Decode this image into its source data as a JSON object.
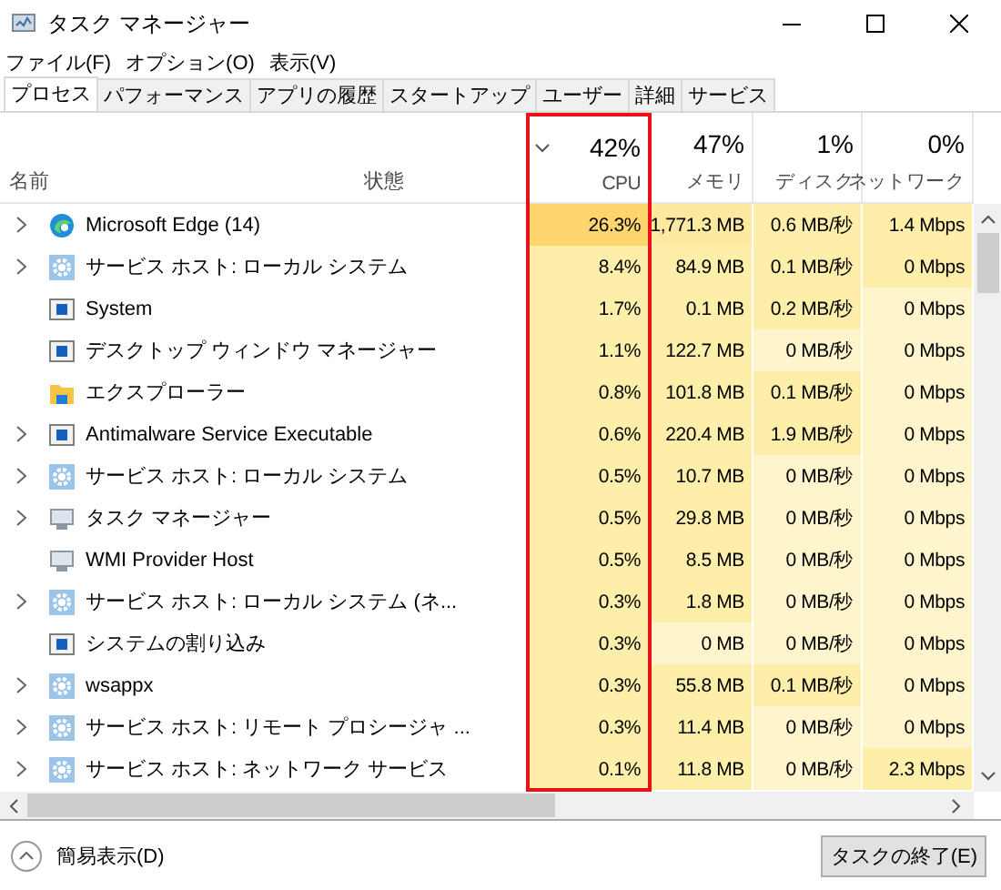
{
  "window": {
    "title": "タスク マネージャー"
  },
  "menu": [
    "ファイル(F)",
    "オプション(O)",
    "表示(V)"
  ],
  "tabs": [
    {
      "label": "プロセス",
      "selected": true
    },
    {
      "label": "パフォーマンス",
      "selected": false
    },
    {
      "label": "アプリの履歴",
      "selected": false
    },
    {
      "label": "スタートアップ",
      "selected": false
    },
    {
      "label": "ユーザー",
      "selected": false
    },
    {
      "label": "詳細",
      "selected": false
    },
    {
      "label": "サービス",
      "selected": false
    }
  ],
  "table": {
    "name_column": "名前",
    "status_column": "状態",
    "metric_columns": [
      {
        "total": "42%",
        "label": "CPU",
        "sorted": true,
        "highlighted": true
      },
      {
        "total": "47%",
        "label": "メモリ"
      },
      {
        "total": "1%",
        "label": "ディスク"
      },
      {
        "total": "0%",
        "label": "ネットワーク"
      }
    ],
    "rows": [
      {
        "name": "Microsoft Edge (14)",
        "kind": "edge",
        "expandable": true,
        "cells": [
          {
            "text": "26.3%",
            "color": "#ffd66e"
          },
          {
            "text": "1,771.3 MB",
            "color": "#fde9a0"
          },
          {
            "text": "0.6 MB/秒",
            "color": "#fdeeaa"
          },
          {
            "text": "1.4 Mbps",
            "color": "#fdeeaa"
          }
        ]
      },
      {
        "name": "サービス ホスト: ローカル システム",
        "kind": "gear",
        "expandable": true,
        "cells": [
          {
            "text": "8.4%",
            "color": "#fdeeaa"
          },
          {
            "text": "84.9 MB",
            "color": "#fdeeaa"
          },
          {
            "text": "0.1 MB/秒",
            "color": "#fdeeaa"
          },
          {
            "text": "0 Mbps",
            "color": "#fdeeaa"
          }
        ]
      },
      {
        "name": "System",
        "kind": "window",
        "expandable": false,
        "cells": [
          {
            "text": "1.7%",
            "color": "#fdeeaa"
          },
          {
            "text": "0.1 MB",
            "color": "#fdeeaa"
          },
          {
            "text": "0.2 MB/秒",
            "color": "#fdeeaa"
          },
          {
            "text": "0 Mbps",
            "color": "#fff5cc"
          }
        ]
      },
      {
        "name": "デスクトップ ウィンドウ マネージャー",
        "kind": "window",
        "expandable": false,
        "cells": [
          {
            "text": "1.1%",
            "color": "#fdeeaa"
          },
          {
            "text": "122.7 MB",
            "color": "#fdeeaa"
          },
          {
            "text": "0 MB/秒",
            "color": "#fff5cc"
          },
          {
            "text": "0 Mbps",
            "color": "#fff5cc"
          }
        ]
      },
      {
        "name": "エクスプローラー",
        "kind": "folder",
        "expandable": false,
        "cells": [
          {
            "text": "0.8%",
            "color": "#fdeeaa"
          },
          {
            "text": "101.8 MB",
            "color": "#fdeeaa"
          },
          {
            "text": "0.1 MB/秒",
            "color": "#fdeeaa"
          },
          {
            "text": "0 Mbps",
            "color": "#fff5cc"
          }
        ]
      },
      {
        "name": "Antimalware Service Executable",
        "kind": "window",
        "expandable": true,
        "cells": [
          {
            "text": "0.6%",
            "color": "#fdeeaa"
          },
          {
            "text": "220.4 MB",
            "color": "#fdeeaa"
          },
          {
            "text": "1.9 MB/秒",
            "color": "#fdeeaa"
          },
          {
            "text": "0 Mbps",
            "color": "#fff5cc"
          }
        ]
      },
      {
        "name": "サービス ホスト: ローカル システム",
        "kind": "gear",
        "expandable": true,
        "cells": [
          {
            "text": "0.5%",
            "color": "#fdeeaa"
          },
          {
            "text": "10.7 MB",
            "color": "#fdeeaa"
          },
          {
            "text": "0 MB/秒",
            "color": "#fff5cc"
          },
          {
            "text": "0 Mbps",
            "color": "#fff5cc"
          }
        ]
      },
      {
        "name": "タスク マネージャー",
        "kind": "monitor",
        "expandable": true,
        "cells": [
          {
            "text": "0.5%",
            "color": "#fdeeaa"
          },
          {
            "text": "29.8 MB",
            "color": "#fdeeaa"
          },
          {
            "text": "0 MB/秒",
            "color": "#fff5cc"
          },
          {
            "text": "0 Mbps",
            "color": "#fff5cc"
          }
        ]
      },
      {
        "name": "WMI Provider Host",
        "kind": "monitor",
        "expandable": false,
        "cells": [
          {
            "text": "0.5%",
            "color": "#fdeeaa"
          },
          {
            "text": "8.5 MB",
            "color": "#fdeeaa"
          },
          {
            "text": "0 MB/秒",
            "color": "#fff5cc"
          },
          {
            "text": "0 Mbps",
            "color": "#fff5cc"
          }
        ]
      },
      {
        "name": "サービス ホスト: ローカル システム (ネ...",
        "kind": "gear",
        "expandable": true,
        "cells": [
          {
            "text": "0.3%",
            "color": "#fdeeaa"
          },
          {
            "text": "1.8 MB",
            "color": "#fdeeaa"
          },
          {
            "text": "0 MB/秒",
            "color": "#fff5cc"
          },
          {
            "text": "0 Mbps",
            "color": "#fff5cc"
          }
        ]
      },
      {
        "name": "システムの割り込み",
        "kind": "window",
        "expandable": false,
        "cells": [
          {
            "text": "0.3%",
            "color": "#fdeeaa"
          },
          {
            "text": "0 MB",
            "color": "#fff5cc"
          },
          {
            "text": "0 MB/秒",
            "color": "#fff5cc"
          },
          {
            "text": "0 Mbps",
            "color": "#fff5cc"
          }
        ]
      },
      {
        "name": "wsappx",
        "kind": "gear",
        "expandable": true,
        "cells": [
          {
            "text": "0.3%",
            "color": "#fdeeaa"
          },
          {
            "text": "55.8 MB",
            "color": "#fdeeaa"
          },
          {
            "text": "0.1 MB/秒",
            "color": "#fdeeaa"
          },
          {
            "text": "0 Mbps",
            "color": "#fff5cc"
          }
        ]
      },
      {
        "name": "サービス ホスト: リモート プロシージャ ...",
        "kind": "gear",
        "expandable": true,
        "cells": [
          {
            "text": "0.3%",
            "color": "#fdeeaa"
          },
          {
            "text": "11.4 MB",
            "color": "#fdeeaa"
          },
          {
            "text": "0 MB/秒",
            "color": "#fff5cc"
          },
          {
            "text": "0 Mbps",
            "color": "#fff5cc"
          }
        ]
      },
      {
        "name": "サービス ホスト: ネットワーク サービス",
        "kind": "gear",
        "expandable": true,
        "cells": [
          {
            "text": "0.1%",
            "color": "#fdeeaa"
          },
          {
            "text": "11.8 MB",
            "color": "#fdeeaa"
          },
          {
            "text": "0 MB/秒",
            "color": "#fff5cc"
          },
          {
            "text": "2.3 Mbps",
            "color": "#fdeeaa"
          }
        ]
      }
    ]
  },
  "footer": {
    "link": "簡易表示(D)",
    "button": "タスクの終了(E)"
  }
}
